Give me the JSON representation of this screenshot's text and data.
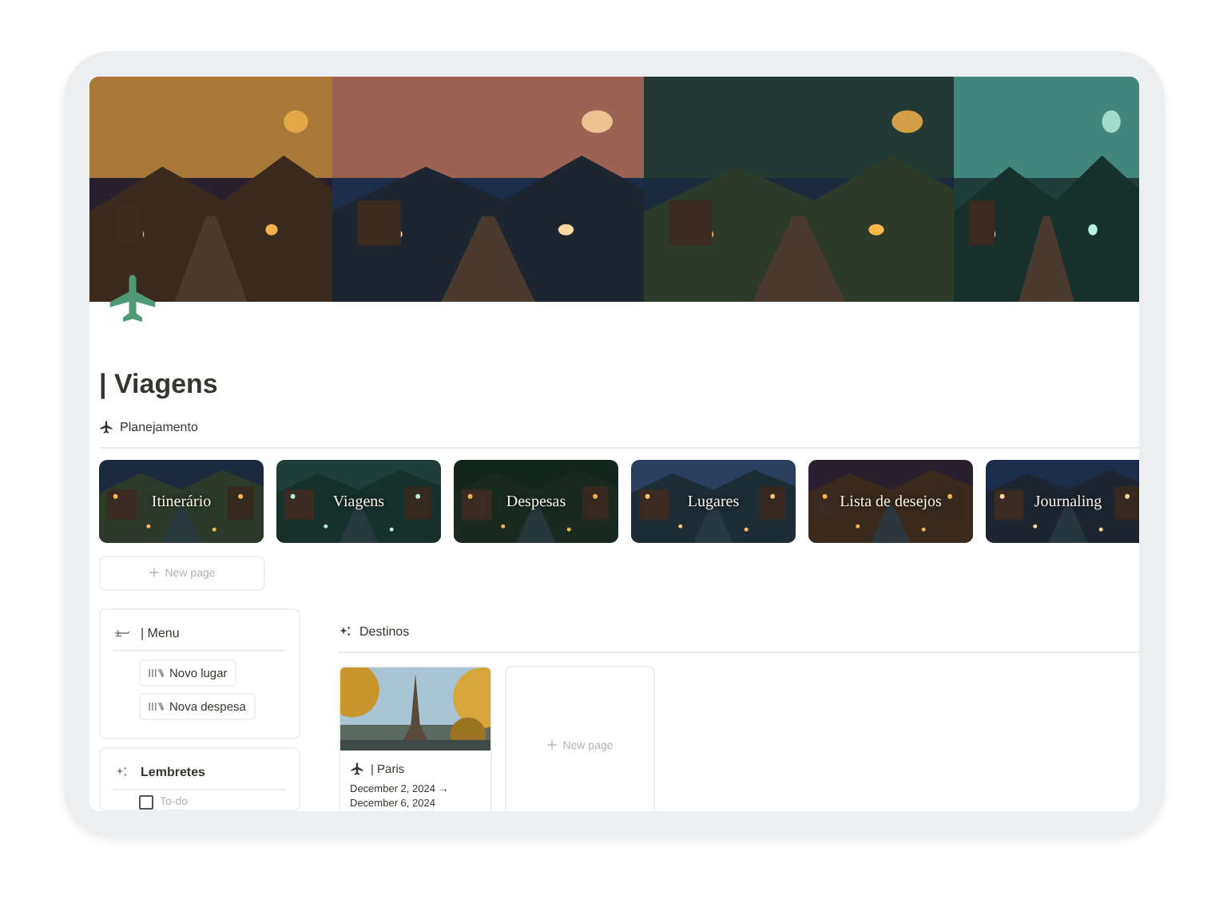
{
  "page": {
    "title": "| Viagens"
  },
  "planning": {
    "heading": "Planejamento",
    "cards": [
      {
        "label": "Itinerário"
      },
      {
        "label": "Viagens"
      },
      {
        "label": "Despesas"
      },
      {
        "label": "Lugares"
      },
      {
        "label": "Lista de desejos"
      },
      {
        "label": "Journaling"
      }
    ],
    "new_page": "New page"
  },
  "menu": {
    "title": "| Menu",
    "buttons": [
      {
        "label": "Novo lugar"
      },
      {
        "label": "Nova despesa"
      }
    ]
  },
  "reminders": {
    "title": "Lembretes",
    "todo": {
      "placeholder": "To-do",
      "checked": false
    }
  },
  "destinations": {
    "heading": "Destinos",
    "items": [
      {
        "title": "| Paris",
        "dates": "December 2, 2024 → December 6, 2024"
      }
    ],
    "new_page": "New page"
  }
}
